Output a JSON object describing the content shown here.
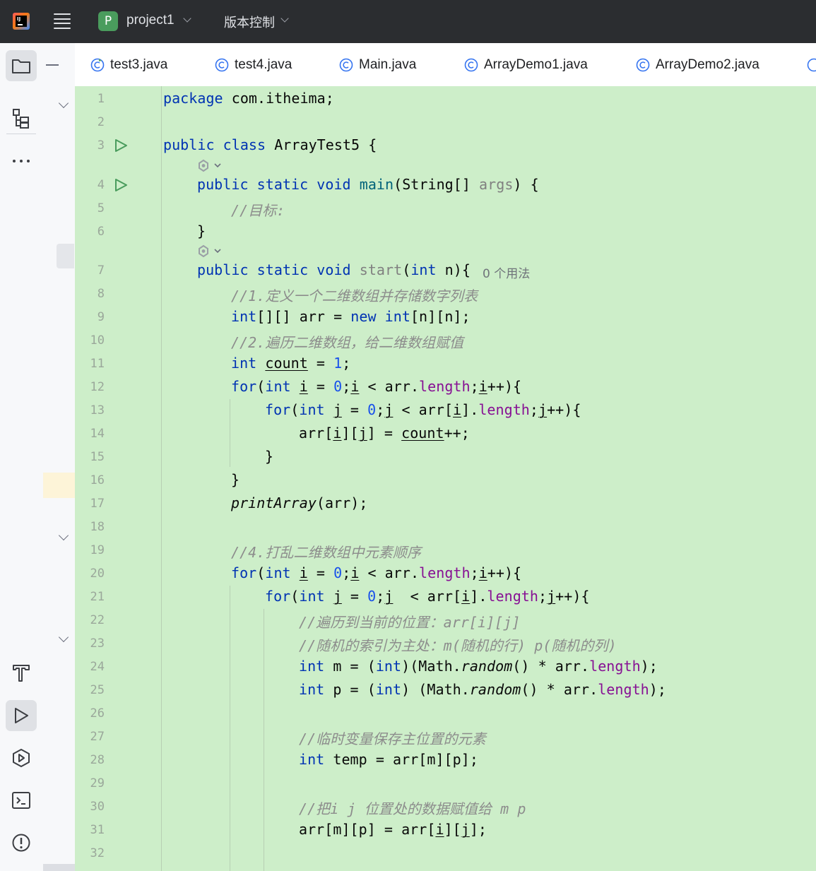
{
  "titlebar": {
    "project_initial": "P",
    "project_name": "project1",
    "vcs_label": "版本控制"
  },
  "tabs": [
    {
      "label": "test3.java"
    },
    {
      "label": "test4.java"
    },
    {
      "label": "Main.java"
    },
    {
      "label": "ArrayDemo1.java"
    },
    {
      "label": "ArrayDemo2.java"
    }
  ],
  "left_toolbar": [
    "folder-icon",
    "structure-icon",
    "more-icon",
    "build-icon",
    "run-icon",
    "services-icon",
    "terminal-icon",
    "problems-icon"
  ],
  "editor": {
    "line_numbers": [
      "1",
      "2",
      "3",
      "4",
      "5",
      "6",
      "7",
      "8",
      "9",
      "10",
      "11",
      "12",
      "13",
      "14",
      "15",
      "16",
      "17",
      "18",
      "19",
      "20",
      "21",
      "22",
      "23",
      "24",
      "25",
      "26",
      "27",
      "28",
      "29",
      "30",
      "31",
      "32"
    ],
    "usage_hint": "0 个用法",
    "lines": {
      "l1": {
        "a": "package",
        "b": " com.itheima;"
      },
      "l3": {
        "a": "public",
        "b": " ",
        "c": "class",
        "d": " ArrayTest5 {"
      },
      "l4": {
        "a": "public",
        "b": " ",
        "c": "static",
        "d": " ",
        "e": "void",
        "f": " ",
        "g": "main",
        "h": "(String[] ",
        "i": "args",
        "j": ") {"
      },
      "l5": {
        "a": "//目标:"
      },
      "l6": {
        "a": "}"
      },
      "l7": {
        "a": "public",
        "b": " ",
        "c": "static",
        "d": " ",
        "e": "void",
        "f": " ",
        "g": "start",
        "h": "(",
        "i": "int",
        "j": " n){"
      },
      "l8": {
        "a": "//1.定义一个二维数组并存储数字列表"
      },
      "l9": {
        "a": "int",
        "b": "[][] arr = ",
        "c": "new",
        "d": " ",
        "e": "int",
        "f": "[n][n];"
      },
      "l10": {
        "a": "//2.遍历二维数组，给二维数组赋值"
      },
      "l11": {
        "a": "int",
        "b": " ",
        "c": "count",
        "d": " = ",
        "e": "1",
        "f": ";"
      },
      "l12": {
        "a": "for",
        "b": "(",
        "c": "int",
        "d": " ",
        "e": "i",
        "f": " = ",
        "g": "0",
        "h": ";",
        "i": "i",
        "j": " < arr.",
        "k": "length",
        "l": ";",
        "m": "i",
        "n": "++){"
      },
      "l13": {
        "a": "for",
        "b": "(",
        "c": "int",
        "d": " ",
        "e": "j",
        "f": " = ",
        "g": "0",
        "h": ";",
        "i": "j",
        "j": " < arr[",
        "k": "i",
        "l": "].",
        "m": "length",
        "n": ";",
        "o": "j",
        "p": "++){"
      },
      "l14": {
        "a": "arr[",
        "b": "i",
        "c": "][",
        "d": "j",
        "e": "] = ",
        "f": "count",
        "g": "++;"
      },
      "l15": {
        "a": "}"
      },
      "l16": {
        "a": "}"
      },
      "l17": {
        "a": "printArray",
        "b": "(arr);"
      },
      "l19": {
        "a": "//4.打乱二维数组中元素顺序"
      },
      "l20": {
        "a": "for",
        "b": "(",
        "c": "int",
        "d": " ",
        "e": "i",
        "f": " = ",
        "g": "0",
        "h": ";",
        "i": "i",
        "j": " < arr.",
        "k": "length",
        "l": ";",
        "m": "i",
        "n": "++){"
      },
      "l21": {
        "a": "for",
        "b": "(",
        "c": "int",
        "d": " ",
        "e": "j",
        "f": " = ",
        "g": "0",
        "h": ";",
        "i": "j",
        "j": "  < arr[",
        "k": "i",
        "l": "].",
        "m": "length",
        "n": ";",
        "o": "j",
        "p": "++){"
      },
      "l22": {
        "a": "//遍历到当前的位置：arr[i][j]"
      },
      "l23": {
        "a": "//随机的索引为主处：m(随机的行) p(随机的列)"
      },
      "l24": {
        "a": "int",
        "b": " m = (",
        "c": "int",
        "d": ")(Math.",
        "e": "random",
        "f": "() * arr.",
        "g": "length",
        "h": ");"
      },
      "l25": {
        "a": "int",
        "b": " p = (",
        "c": "int",
        "d": ") (Math.",
        "e": "random",
        "f": "() * arr.",
        "g": "length",
        "h": ");"
      },
      "l27": {
        "a": "//临时变量保存主位置的元素"
      },
      "l28": {
        "a": "int",
        "b": " temp = arr[m][p];"
      },
      "l30": {
        "a": "//把i j 位置处的数据赋值给 m p"
      },
      "l31": {
        "a": "arr[m][p] = arr[",
        "b": "i",
        "c": "][",
        "d": "j",
        "e": "];"
      }
    }
  },
  "colors": {
    "editor_background": "#cdeec9",
    "keyword": "#0033b3",
    "number": "#1750eb",
    "method": "#00627a",
    "field": "#871094",
    "comment": "#8c8c8c"
  }
}
